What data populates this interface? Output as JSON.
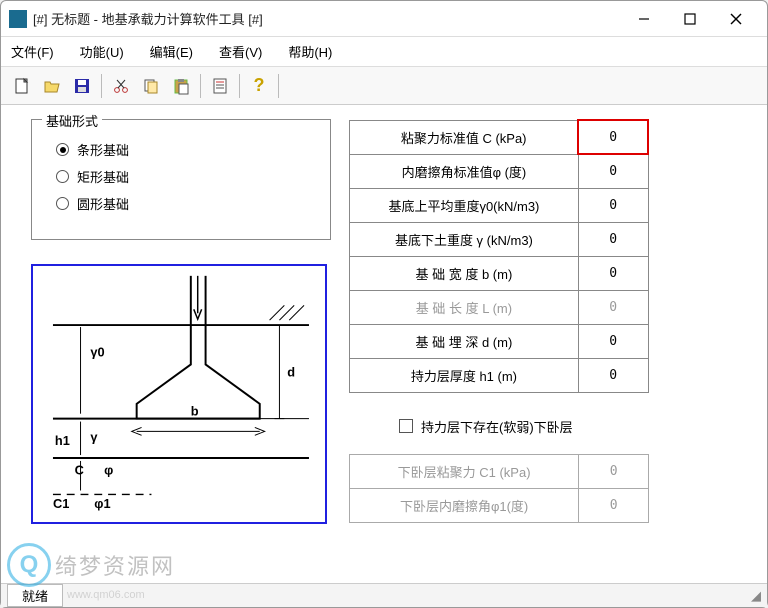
{
  "title": "[#] 无标题 - 地基承载力计算软件工具 [#]",
  "menu": {
    "file": "文件(F)",
    "func": "功能(U)",
    "edit": "编辑(E)",
    "view": "查看(V)",
    "help": "帮助(H)"
  },
  "fieldset": {
    "legend": "基础形式",
    "opt1": "条形基础",
    "opt2": "矩形基础",
    "opt3": "圆形基础"
  },
  "params": [
    {
      "label": "粘聚力标准值 C  (kPa)",
      "value": "0",
      "active": true,
      "disabled": false
    },
    {
      "label": "内磨擦角标准值φ (度)",
      "value": "0",
      "active": false,
      "disabled": false
    },
    {
      "label": "基底上平均重度γ0(kN/m3)",
      "value": "0",
      "active": false,
      "disabled": false
    },
    {
      "label": "基底下土重度 γ (kN/m3)",
      "value": "0",
      "active": false,
      "disabled": false
    },
    {
      "label": "基 础 宽 度 b   (m)",
      "value": "0",
      "active": false,
      "disabled": false
    },
    {
      "label": "基 础 长 度 L   (m)",
      "value": "0",
      "active": false,
      "disabled": true
    },
    {
      "label": "基 础 埋 深 d   (m)",
      "value": "0",
      "active": false,
      "disabled": false
    },
    {
      "label": "持力层厚度 h1   (m)",
      "value": "0",
      "active": false,
      "disabled": false
    }
  ],
  "checkbox": {
    "label": "持力层下存在(软弱)下卧层",
    "checked": false
  },
  "subparams": [
    {
      "label": "下卧层粘聚力 C1 (kPa)",
      "value": "0"
    },
    {
      "label": "下卧层内磨擦角φ1(度)",
      "value": "0"
    }
  ],
  "status": {
    "ready": "就绪"
  },
  "watermark": {
    "text": "绮梦资源网",
    "url": "www.qm06.com"
  }
}
